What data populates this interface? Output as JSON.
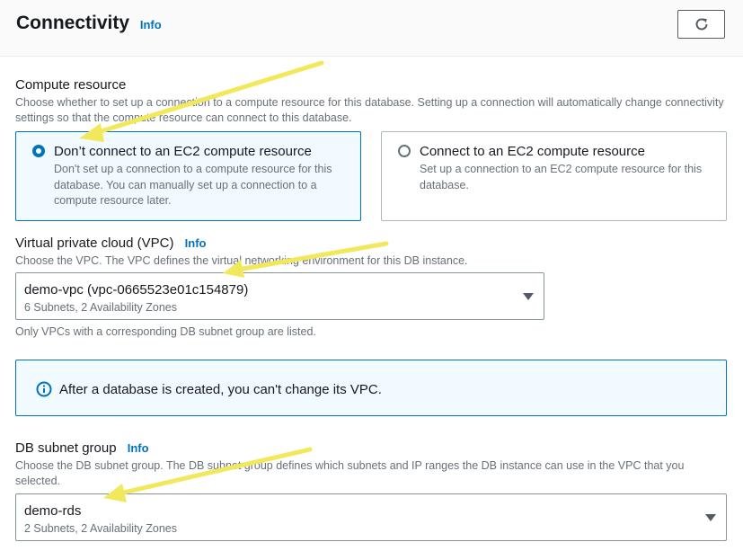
{
  "header": {
    "title": "Connectivity",
    "info": "Info",
    "refresh_icon": "refresh-icon"
  },
  "compute": {
    "label": "Compute resource",
    "description": "Choose whether to set up a connection to a compute resource for this database. Setting up a connection will automatically change connectivity settings so that the compute resource can connect to this database.",
    "options": [
      {
        "title": "Don’t connect to an EC2 compute resource",
        "description": "Don't set up a connection to a compute resource for this database. You can manually set up a connection to a compute resource later.",
        "selected": true
      },
      {
        "title": "Connect to an EC2 compute resource",
        "description": "Set up a connection to an EC2 compute resource for this database.",
        "selected": false
      }
    ]
  },
  "vpc": {
    "label": "Virtual private cloud (VPC)",
    "info": "Info",
    "description": "Choose the VPC. The VPC defines the virtual networking environment for this DB instance.",
    "selected_value": "demo-vpc (vpc-0665523e01c154879)",
    "selected_sub": "6 Subnets, 2 Availability Zones",
    "hint": "Only VPCs with a corresponding DB subnet group are listed."
  },
  "alert": {
    "icon": "info-circle-icon",
    "text": "After a database is created, you can't change its VPC."
  },
  "subnet": {
    "label": "DB subnet group",
    "info": "Info",
    "description": "Choose the DB subnet group. The DB subnet group defines which subnets and IP ranges the DB instance can use in the VPC that you selected.",
    "selected_value": "demo-rds",
    "selected_sub": "2 Subnets, 2 Availability Zones"
  },
  "colors": {
    "accent": "#0073bb",
    "annotation_arrow": "#f2e85c"
  }
}
